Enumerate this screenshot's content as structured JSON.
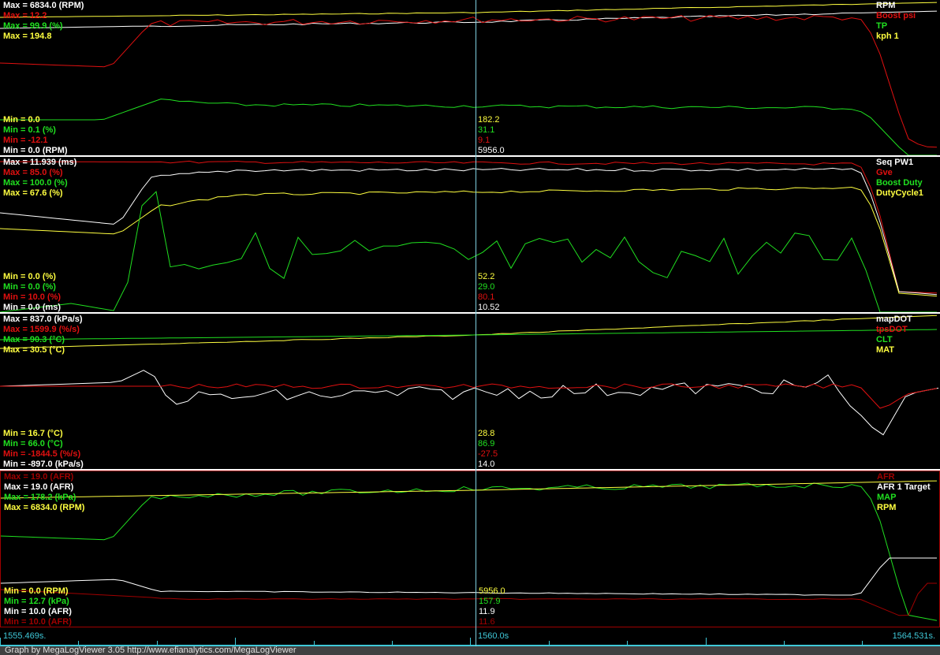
{
  "colors": {
    "white": "#ffffff",
    "red": "#e01010",
    "green": "#20e020",
    "yellow": "#ffff40",
    "darkred": "#a00000",
    "cyan": "#3fc8d8"
  },
  "panels": [
    {
      "max": [
        "Max = 6834.0 (RPM)",
        "Max = 12.2",
        "Max = 99.9 (%)",
        "Max = 194.8"
      ],
      "min": [
        "Min = 0.0",
        "Min = 0.1 (%)",
        "Min = -12.1",
        "Min = 0.0 (RPM)"
      ],
      "legend": [
        "RPM",
        "Boost psi",
        "TP",
        "kph 1"
      ],
      "cursor": [
        "182.2",
        "31.1",
        "9.1",
        "5956.0"
      ]
    },
    {
      "max": [
        "Max = 11.939 (ms)",
        "Max = 85.0 (%)",
        "Max = 100.0 (%)",
        "Max = 67.6 (%)"
      ],
      "min": [
        "Min = 0.0 (%)",
        "Min = 0.0 (%)",
        "Min = 10.0 (%)",
        "Min = 0.0 (ms)"
      ],
      "legend": [
        "Seq PW1",
        "Gve",
        "Boost Duty",
        "DutyCycle1"
      ],
      "cursor": [
        "52.2",
        "29.0",
        "80.1",
        "10.52"
      ]
    },
    {
      "max": [
        "Max = 837.0 (kPa/s)",
        "Max = 1599.9 (%/s)",
        "Max = 90.3 (°C)",
        "Max = 30.5 (°C)"
      ],
      "min": [
        "Min = 16.7 (°C)",
        "Min = 66.0 (°C)",
        "Min = -1844.5 (%/s)",
        "Min = -897.0 (kPa/s)"
      ],
      "legend": [
        "mapDOT",
        "tpsDOT",
        "CLT",
        "MAT"
      ],
      "cursor": [
        "28.8",
        "86.9",
        "-27.5",
        "14.0"
      ]
    },
    {
      "max": [
        "Max = 19.0 (AFR)",
        "Max = 19.0 (AFR)",
        "Max = 178.2 (kPa)",
        "Max = 6834.0 (RPM)"
      ],
      "min": [
        "Min = 0.0 (RPM)",
        "Min = 12.7 (kPa)",
        "Min = 10.0 (AFR)",
        "Min = 10.0 (AFR)"
      ],
      "legend": [
        "AFR",
        "AFR 1 Target",
        "MAP",
        "RPM"
      ],
      "cursor": [
        "5956.0",
        "157.9",
        "11.9",
        "11.6"
      ]
    }
  ],
  "timeline": {
    "start": "1555.469s.",
    "cursor": "1560.0s",
    "end": "1564.531s."
  },
  "footer": "Graph by MegaLogViewer 3.05 http://www.efianalytics.com/MegaLogViewer"
}
